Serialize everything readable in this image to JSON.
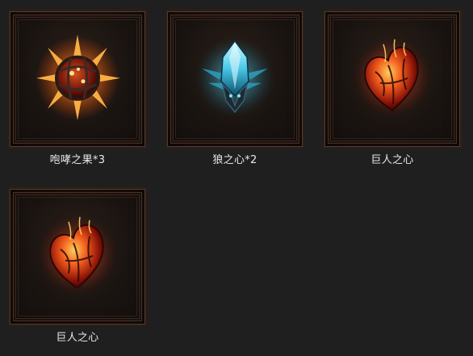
{
  "rewards": [
    {
      "label": "咆哮之果*3",
      "icon": "roaring-fruit-icon"
    },
    {
      "label": "狼之心*2",
      "icon": "wolf-heart-icon"
    },
    {
      "label": "巨人之心",
      "icon": "giant-heart-icon"
    },
    {
      "label": "巨人之心",
      "icon": "giant-heart-icon"
    }
  ]
}
